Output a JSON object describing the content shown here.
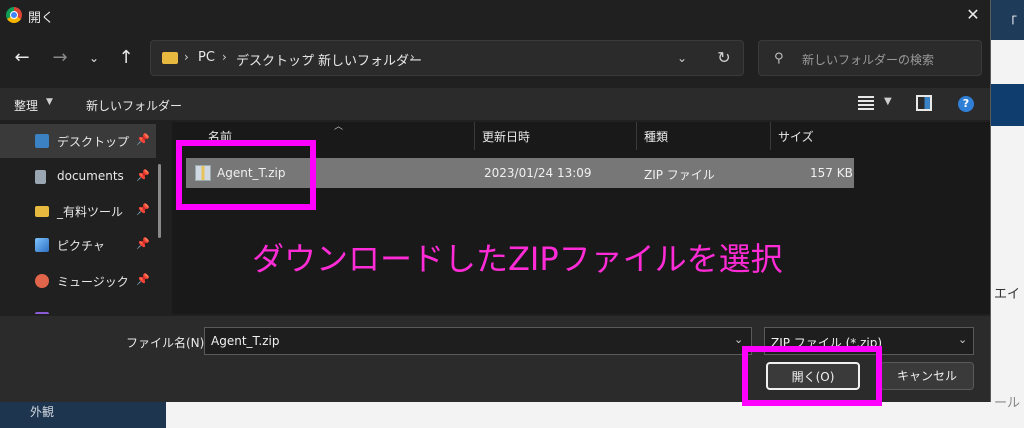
{
  "window": {
    "title": "開く"
  },
  "nav": {
    "breadcrumbs": [
      "PC",
      "デスクトップ",
      "新しいフォルダー"
    ],
    "search_placeholder": "新しいフォルダーの検索"
  },
  "toolbar": {
    "organize": "整理",
    "new_folder": "新しいフォルダー"
  },
  "sidebar": {
    "items": [
      {
        "label": "デスクトップ",
        "icon": "desktop-icon",
        "color": "#3b82c4"
      },
      {
        "label": "documents",
        "icon": "document-icon",
        "color": "#9aa6b2"
      },
      {
        "label": "_有料ツール",
        "icon": "folder-icon",
        "color": "#e7b93e"
      },
      {
        "label": "ピクチャ",
        "icon": "picture-icon",
        "color": "#3b8be0"
      },
      {
        "label": "ミュージック",
        "icon": "music-icon",
        "color": "#e0654a"
      }
    ]
  },
  "filelist": {
    "columns": {
      "name": "名前",
      "date": "更新日時",
      "type": "種類",
      "size": "サイズ"
    },
    "rows": [
      {
        "name": "Agent_T.zip",
        "date": "2023/01/24 13:09",
        "type": "ZIP ファイル",
        "size": "157 KB"
      }
    ]
  },
  "annotation": "ダウンロードしたZIPファイルを選択",
  "bottom": {
    "filename_label": "ファイル名(N):",
    "filename_value": "Agent_T.zip",
    "filetype": "ZIP ファイル (*.zip)",
    "open_label": "開く(O)",
    "cancel_label": "キャンセル"
  },
  "background": {
    "fragments": [
      "「",
      "エイ",
      "ール"
    ],
    "bottom_left": "外観"
  },
  "colors": {
    "highlight": "#ff00ff",
    "annotation": "#ff2bd6",
    "dialog_bg": "#202020"
  }
}
